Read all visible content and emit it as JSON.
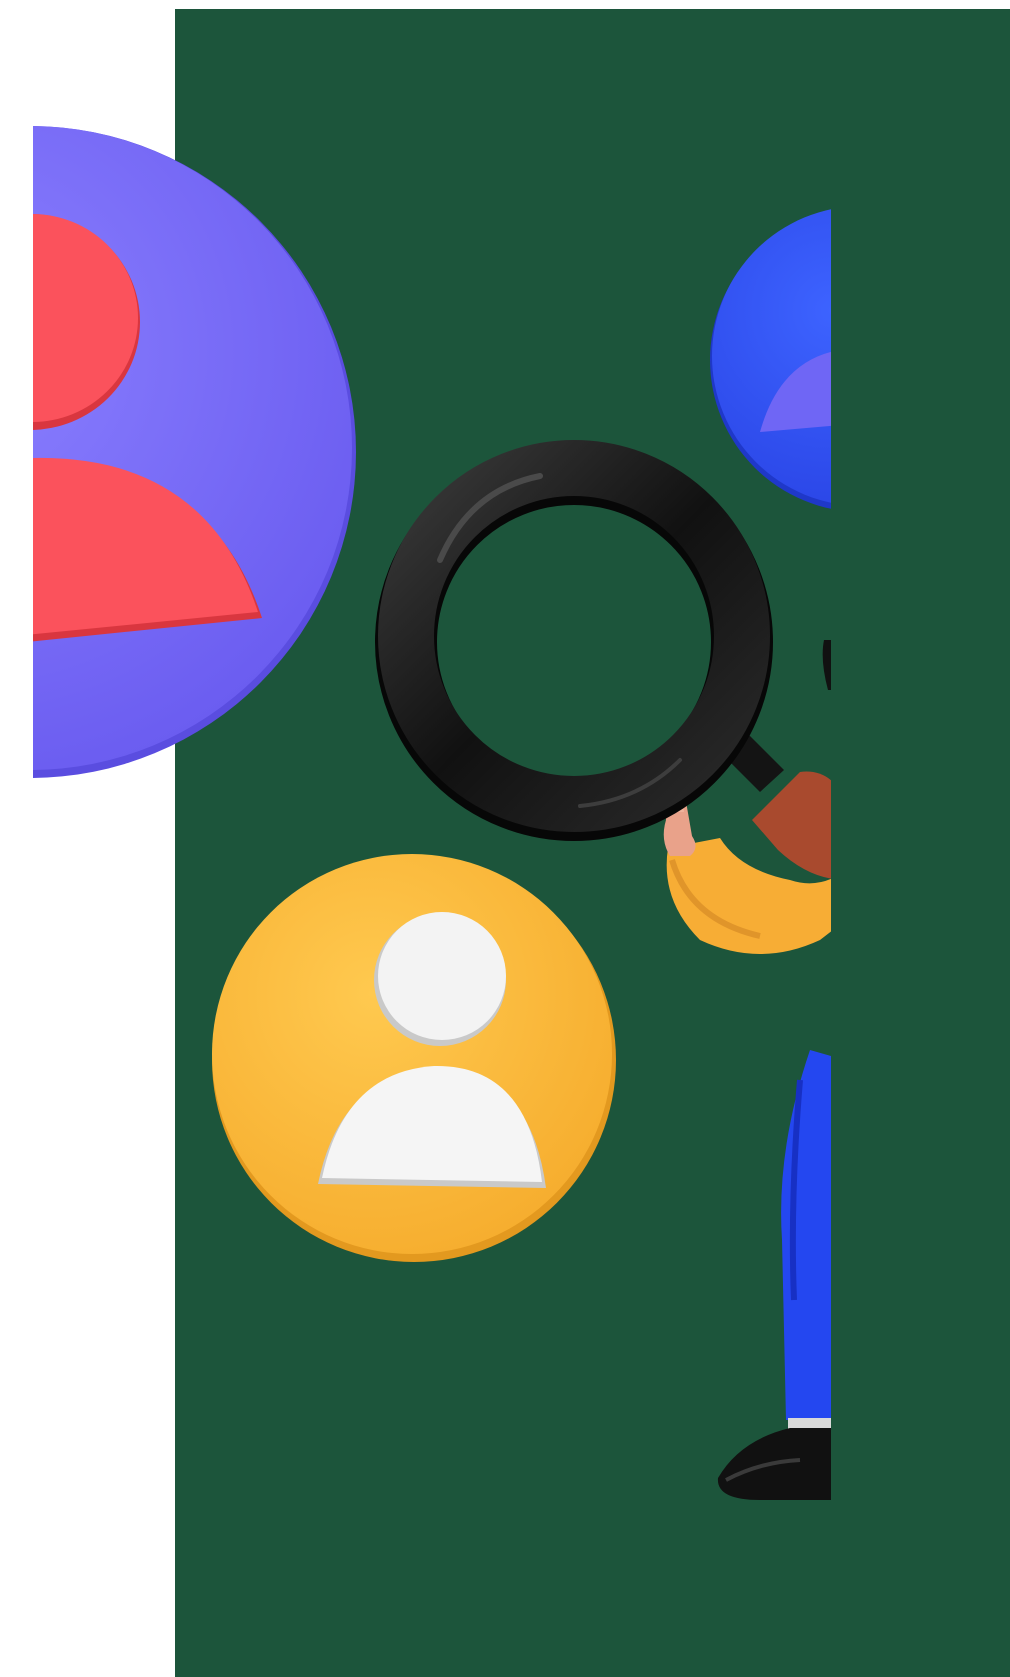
{
  "scene": {
    "description_free": true,
    "colors": {
      "page_background": "#ffffff",
      "panel_green": "#1c553b",
      "purple_circle": "#7a6cf7",
      "red_user": "#fb505a",
      "blue_circle": "#2f52f2",
      "yellow_circle": "#fbb93e",
      "white_user": "#f3f3f3",
      "magnifier_black": "#141414",
      "sleeve_yellow": "#f7ad35",
      "handle_brown": "#a94a2e",
      "skin": "#e9a28a",
      "trousers_blue": "#2447f0",
      "shoe_black": "#111111"
    },
    "icons": [
      "user-avatar-icon",
      "magnifying-glass-icon",
      "user-avatar-icon",
      "user-avatar-icon"
    ]
  }
}
